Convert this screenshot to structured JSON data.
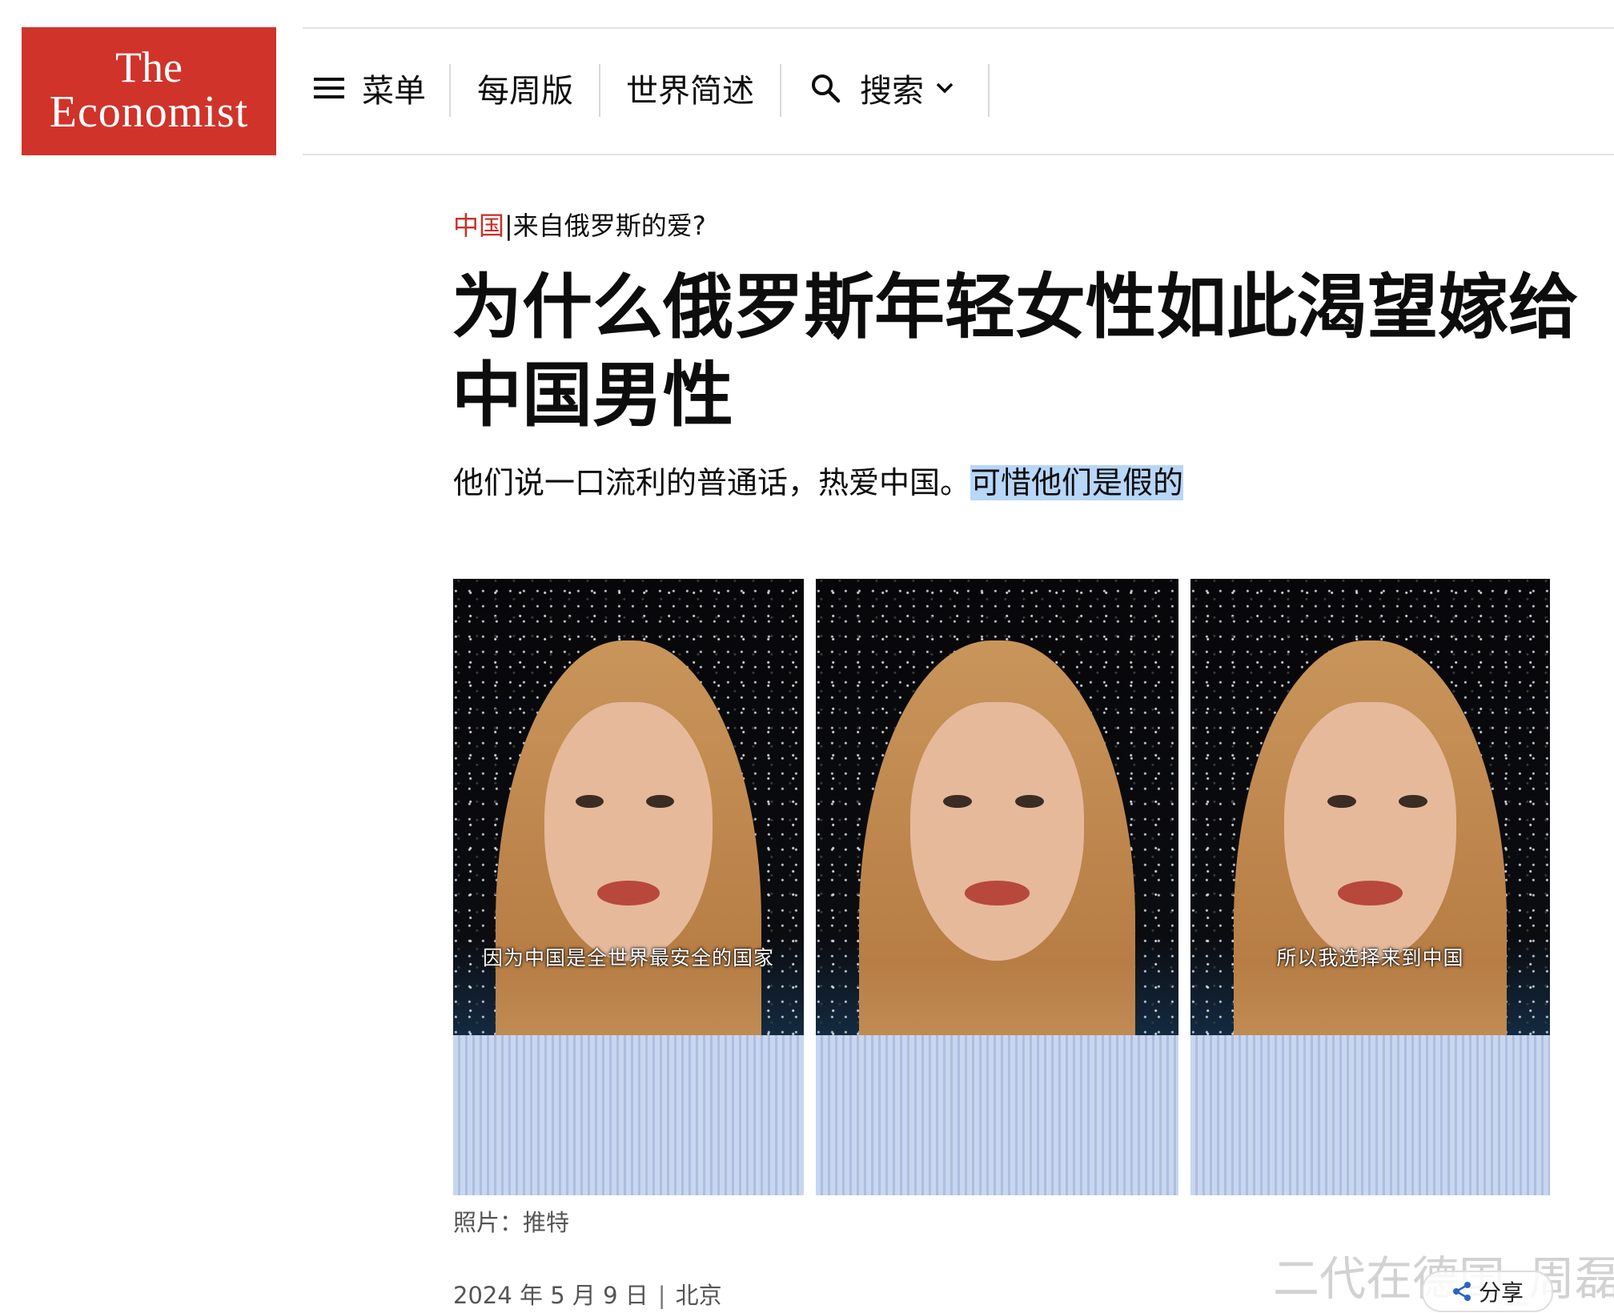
{
  "logo": {
    "line1": "The",
    "line2": "Economist",
    "color": "#d0332a"
  },
  "nav": {
    "menu_label": "菜单",
    "weekly_label": "每周版",
    "world_brief_label": "世界简述",
    "search_label": "搜索"
  },
  "article": {
    "section": "中国",
    "separator": "|",
    "rubric": "来自俄罗斯的爱?",
    "headline": "为什么俄罗斯年轻女性如此渴望嫁给中国男性",
    "subhead_plain": "他们说一口流利的普通话，热爱中国。",
    "subhead_highlight": "可惜他们是假的",
    "highlight_color": "#b8d6f8",
    "section_color": "#c8302a"
  },
  "photos": [
    {
      "caption": "因为中国是全世界最安全的国家"
    },
    {
      "caption": ""
    },
    {
      "caption": "所以我选择来到中国"
    }
  ],
  "credit": "照片：推特",
  "dateline": {
    "date": "2024 年 5 月 9 日",
    "pipe": "|",
    "location": "北京"
  },
  "overlay": {
    "watermark": "二代在德国_周磊",
    "share_label": "分享"
  }
}
